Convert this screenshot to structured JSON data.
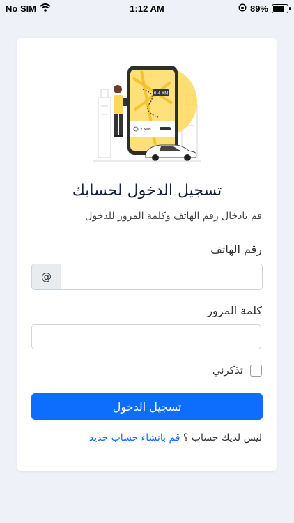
{
  "status_bar": {
    "carrier": "No SIM",
    "time": "1:12 AM",
    "battery": "89%",
    "battery_level": 0.89
  },
  "illustration": {
    "distance_badge": "0.4 KM",
    "eta_badge": "2 MIN"
  },
  "login": {
    "title": "تسجيل الدخول لحسابك",
    "subtitle": "قم بادخال رقم الهاتف وكلمة المرور للدخول",
    "phone_label": "رقم الهاتف",
    "phone_addon": "@",
    "phone_value": "",
    "password_label": "كلمة المرور",
    "password_value": "",
    "remember_label": "تذكرني",
    "submit_label": "تسجيل الدخول",
    "no_account_text": "ليس لديك حساب ؟",
    "signup_link": "قم بانشاء حساب جديد"
  },
  "colors": {
    "primary": "#0d6efd",
    "background": "#eef1f7",
    "title": "#14213d",
    "map_accent": "#ffcc33"
  }
}
